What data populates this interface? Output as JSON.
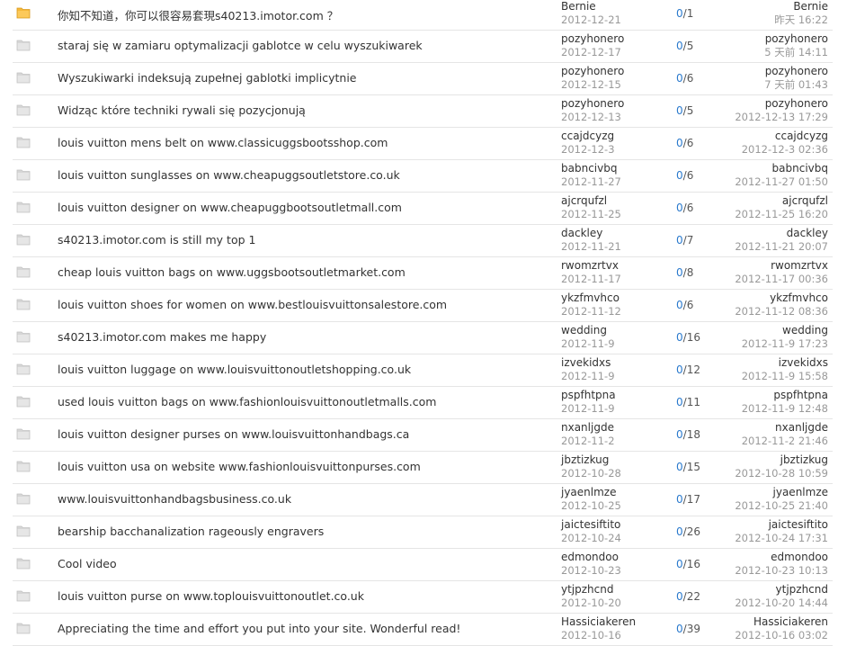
{
  "icons": {
    "new": "folder-new-icon",
    "normal": "folder-icon",
    "new_color": "#f5b83a",
    "normal_color": "#d6d6d6"
  },
  "threads": [
    {
      "icon": "new",
      "title": "你知不知道，你可以很容易套現s40213.imotor.com ？",
      "author": "Bernie",
      "date": "2012-12-21",
      "replies": "0",
      "views": "1",
      "last_user": "Bernie",
      "last_time": "昨天 16:22"
    },
    {
      "icon": "normal",
      "title": "staraj się w zamiaru optymalizacji gablotce w celu wyszukiwarek",
      "author": "pozyhonero",
      "date": "2012-12-17",
      "replies": "0",
      "views": "5",
      "last_user": "pozyhonero",
      "last_time": "5 天前 14:11"
    },
    {
      "icon": "normal",
      "title": "Wyszukiwarki indeksują zupełnej gablotki implicytnie",
      "author": "pozyhonero",
      "date": "2012-12-15",
      "replies": "0",
      "views": "6",
      "last_user": "pozyhonero",
      "last_time": "7 天前 01:43"
    },
    {
      "icon": "normal",
      "title": "Widząc które techniki rywali się pozycjonują",
      "author": "pozyhonero",
      "date": "2012-12-13",
      "replies": "0",
      "views": "5",
      "last_user": "pozyhonero",
      "last_time": "2012-12-13 17:29"
    },
    {
      "icon": "normal",
      "title": "louis vuitton mens belt on www.classicuggsbootsshop.com",
      "author": "ccajdcyzg",
      "date": "2012-12-3",
      "replies": "0",
      "views": "6",
      "last_user": "ccajdcyzg",
      "last_time": "2012-12-3 02:36"
    },
    {
      "icon": "normal",
      "title": "louis vuitton sunglasses on www.cheapuggsoutletstore.co.uk",
      "author": "babncivbq",
      "date": "2012-11-27",
      "replies": "0",
      "views": "6",
      "last_user": "babncivbq",
      "last_time": "2012-11-27 01:50"
    },
    {
      "icon": "normal",
      "title": "louis vuitton designer on www.cheapuggbootsoutletmall.com",
      "author": "ajcrqufzl",
      "date": "2012-11-25",
      "replies": "0",
      "views": "6",
      "last_user": "ajcrqufzl",
      "last_time": "2012-11-25 16:20"
    },
    {
      "icon": "normal",
      "title": "s40213.imotor.com is still my top 1",
      "author": "dackley",
      "date": "2012-11-21",
      "replies": "0",
      "views": "7",
      "last_user": "dackley",
      "last_time": "2012-11-21 20:07"
    },
    {
      "icon": "normal",
      "title": "cheap louis vuitton bags on www.uggsbootsoutletmarket.com",
      "author": "rwomzrtvx",
      "date": "2012-11-17",
      "replies": "0",
      "views": "8",
      "last_user": "rwomzrtvx",
      "last_time": "2012-11-17 00:36"
    },
    {
      "icon": "normal",
      "title": "louis vuitton shoes for women on www.bestlouisvuittonsalestore.com",
      "author": "ykzfmvhco",
      "date": "2012-11-12",
      "replies": "0",
      "views": "6",
      "last_user": "ykzfmvhco",
      "last_time": "2012-11-12 08:36"
    },
    {
      "icon": "normal",
      "title": "s40213.imotor.com makes me happy",
      "author": "wedding",
      "date": "2012-11-9",
      "replies": "0",
      "views": "16",
      "last_user": "wedding",
      "last_time": "2012-11-9 17:23"
    },
    {
      "icon": "normal",
      "title": "louis vuitton luggage on www.louisvuittonoutletshopping.co.uk",
      "author": "izvekidxs",
      "date": "2012-11-9",
      "replies": "0",
      "views": "12",
      "last_user": "izvekidxs",
      "last_time": "2012-11-9 15:58"
    },
    {
      "icon": "normal",
      "title": "used louis vuitton bags on www.fashionlouisvuittonoutletmalls.com",
      "author": "pspfhtpna",
      "date": "2012-11-9",
      "replies": "0",
      "views": "11",
      "last_user": "pspfhtpna",
      "last_time": "2012-11-9 12:48"
    },
    {
      "icon": "normal",
      "title": "louis vuitton designer purses on www.louisvuittonhandbags.ca",
      "author": "nxanljgde",
      "date": "2012-11-2",
      "replies": "0",
      "views": "18",
      "last_user": "nxanljgde",
      "last_time": "2012-11-2 21:46"
    },
    {
      "icon": "normal",
      "title": "louis vuitton usa on website www.fashionlouisvuittonpurses.com",
      "author": "jbztizkug",
      "date": "2012-10-28",
      "replies": "0",
      "views": "15",
      "last_user": "jbztizkug",
      "last_time": "2012-10-28 10:59"
    },
    {
      "icon": "normal",
      "title": "www.louisvuittonhandbagsbusiness.co.uk",
      "author": "jyaenlmze",
      "date": "2012-10-25",
      "replies": "0",
      "views": "17",
      "last_user": "jyaenlmze",
      "last_time": "2012-10-25 21:40"
    },
    {
      "icon": "normal",
      "title": "bearship bacchanalization rageously engravers",
      "author": "jaictesiftito",
      "date": "2012-10-24",
      "replies": "0",
      "views": "26",
      "last_user": "jaictesiftito",
      "last_time": "2012-10-24 17:31"
    },
    {
      "icon": "normal",
      "title": "Cool video",
      "author": "edmondoo",
      "date": "2012-10-23",
      "replies": "0",
      "views": "16",
      "last_user": "edmondoo",
      "last_time": "2012-10-23 10:13"
    },
    {
      "icon": "normal",
      "title": "louis vuitton purse on www.toplouisvuittonoutlet.co.uk",
      "author": "ytjpzhcnd",
      "date": "2012-10-20",
      "replies": "0",
      "views": "22",
      "last_user": "ytjpzhcnd",
      "last_time": "2012-10-20 14:44"
    },
    {
      "icon": "normal",
      "title": "Appreciating the time and effort you put into your site. Wonderful read!",
      "author": "Hassiciakeren",
      "date": "2012-10-16",
      "replies": "0",
      "views": "39",
      "last_user": "Hassiciakeren",
      "last_time": "2012-10-16 03:02"
    }
  ]
}
